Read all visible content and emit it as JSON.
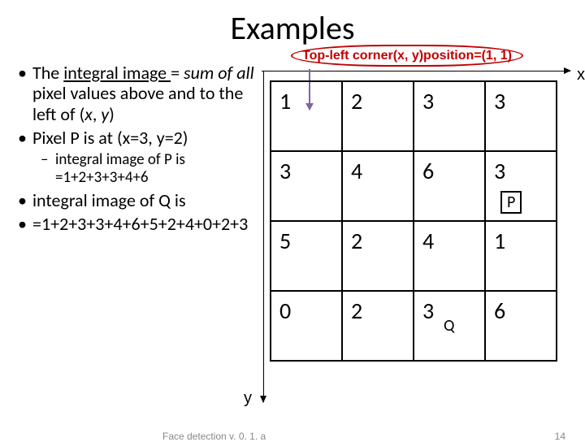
{
  "title": "Examples",
  "bullets": {
    "b1_part1": "The ",
    "b1_under": "integral image ",
    "b1_part2": "= ",
    "b1_ital": "sum of all",
    "b1_part3": " pixel values above and to the left of (",
    "b1_ital2": "x",
    "b1_part4": ", ",
    "b1_ital3": "y",
    "b1_part5": ")",
    "b2": "Pixel P is at (x=3, y=2)",
    "sub1": "integral image of P is =1+2+3+3+4+6",
    "b3": "integral image of Q is",
    "b4": "=1+2+3+3+4+6+5+2+4+0+2+3"
  },
  "annotation": "Top-left corner(x, y)position=(1, 1)",
  "axes": {
    "x": "x",
    "y": "y"
  },
  "grid": [
    [
      "1",
      "2",
      "3",
      "3"
    ],
    [
      "3",
      "4",
      "6",
      "3"
    ],
    [
      "5",
      "2",
      "4",
      "1"
    ],
    [
      "0",
      "2",
      "3",
      "6"
    ]
  ],
  "markers": {
    "p": "P",
    "q": "Q"
  },
  "footer": {
    "left": "Face detection v. 0. 1. a",
    "page": "14"
  }
}
